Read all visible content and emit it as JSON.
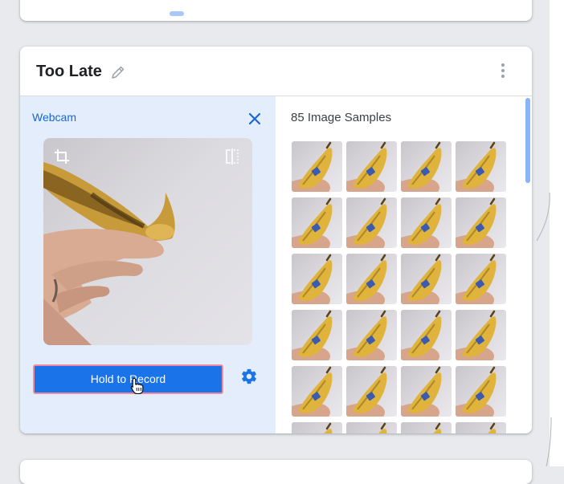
{
  "top_card": {},
  "class_card": {
    "name": "Too Late",
    "webcam": {
      "label": "Webcam",
      "record_label": "Hold to Record"
    },
    "samples": {
      "label": "85 Image Samples",
      "visible_thumbnails": 24
    }
  },
  "icons": {
    "edit": "pencil-icon",
    "more": "kebab-menu-icon",
    "close": "close-icon",
    "crop": "crop-icon",
    "flip": "flip-icon",
    "settings": "gear-icon",
    "cursor": "hand-pointer-icon"
  },
  "colors": {
    "accent": "#1a73e8",
    "panel": "#e3edfb",
    "scroll_thumb": "#8ab4f8",
    "record_border": "#f28b9e"
  }
}
